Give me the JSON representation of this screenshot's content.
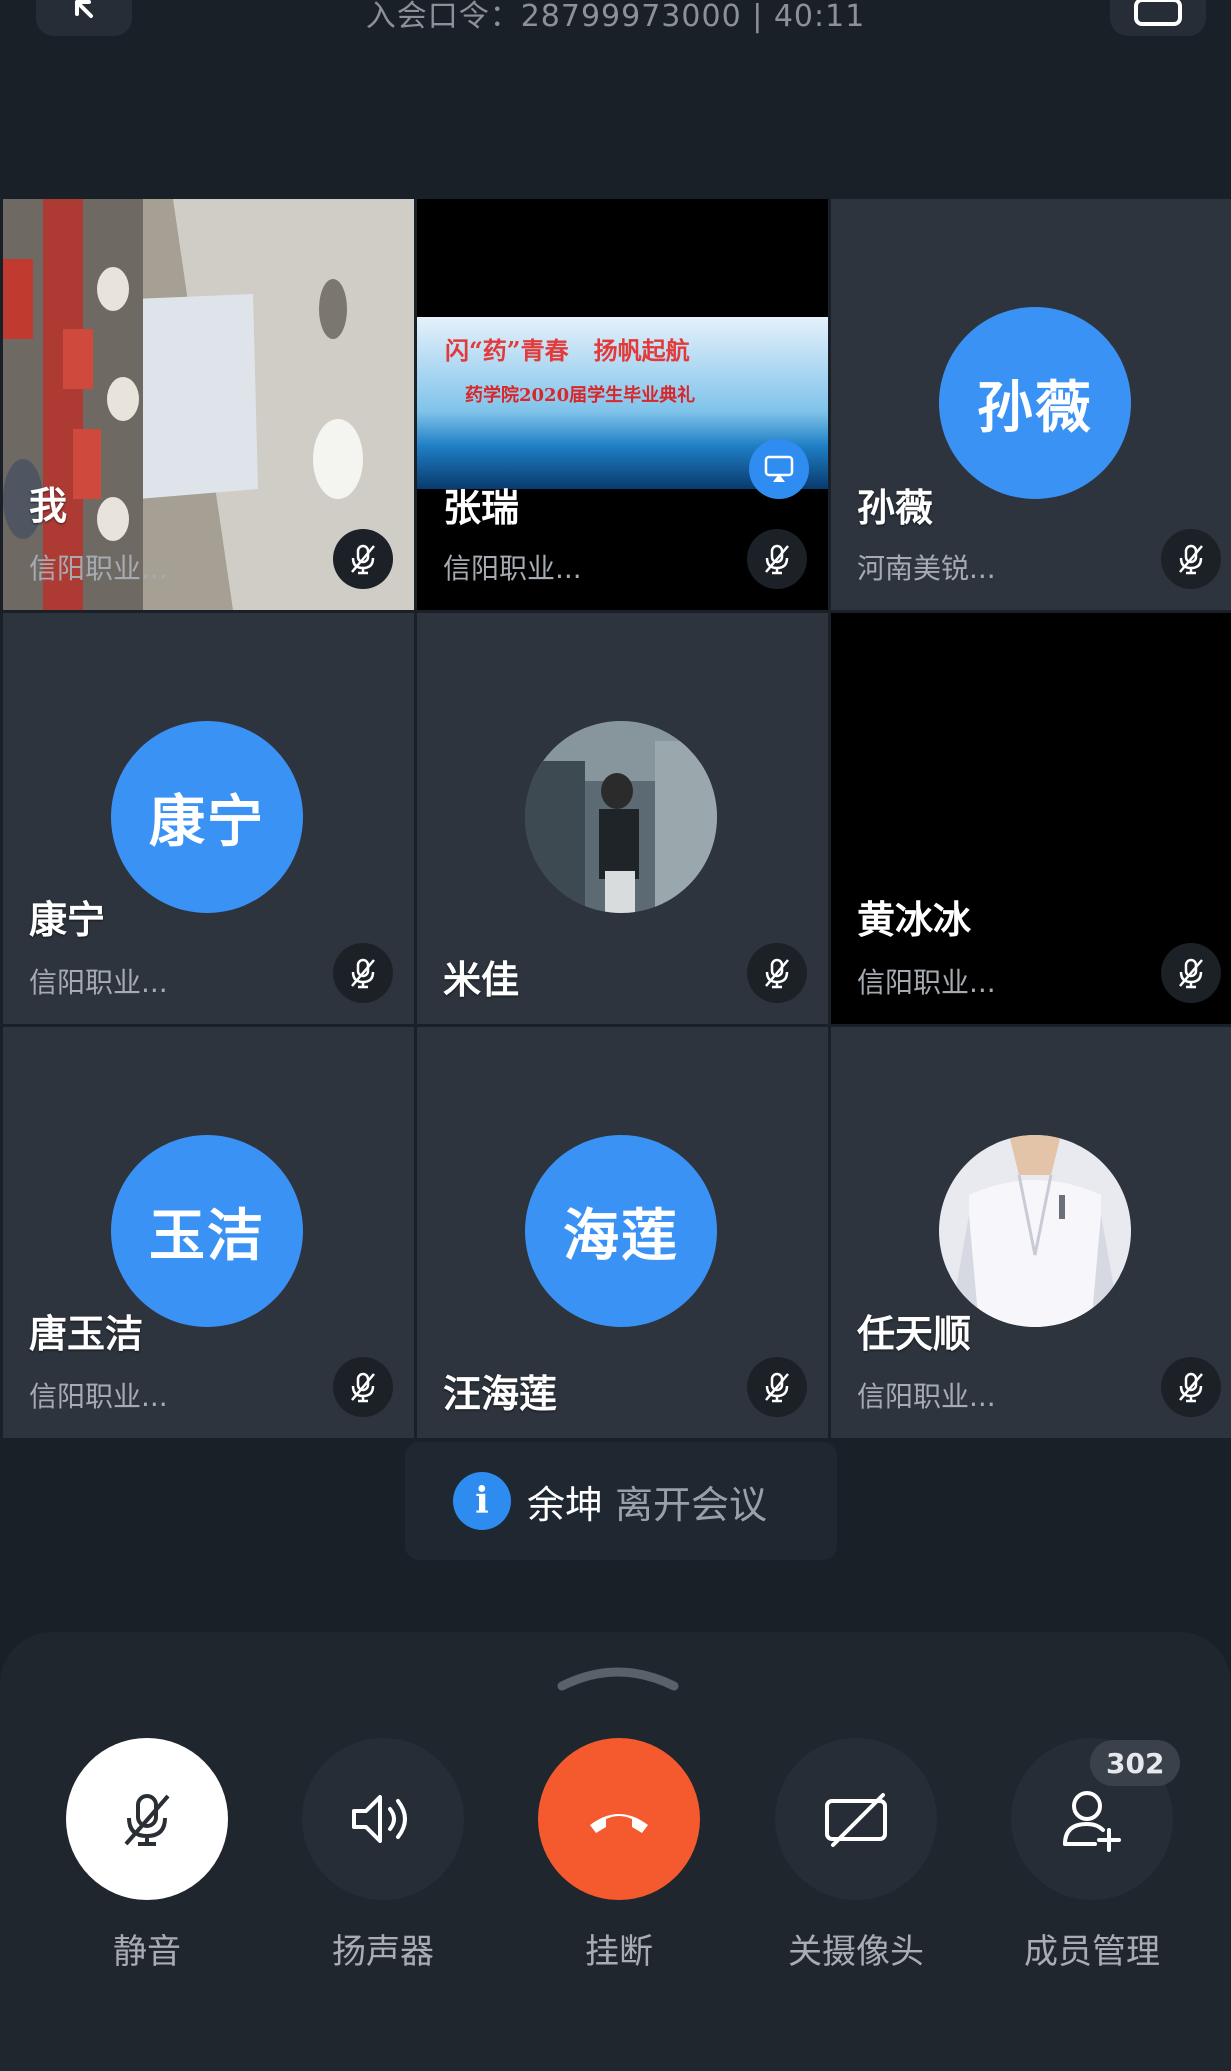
{
  "header": {
    "meeting_info": "入会口令：28799973000 | 40:11",
    "back_icon": "back-arrow-icon",
    "switch_icon": "camera-switch-icon"
  },
  "participants": [
    {
      "name": "我",
      "org": "信阳职业...",
      "type": "video",
      "muted": true
    },
    {
      "name": "张瑞",
      "org": "信阳职业...",
      "type": "screen-share",
      "muted": true,
      "share_title": "闪“药”青春   扬帆起航",
      "share_subtitle": "药学院2020届学生毕业典礼"
    },
    {
      "name": "孙薇",
      "org": "河南美锐...",
      "type": "avatar",
      "avatar_text": "孙薇",
      "muted": true
    },
    {
      "name": "康宁",
      "org": "信阳职业...",
      "type": "avatar",
      "avatar_text": "康宁",
      "muted": true
    },
    {
      "name": "米佳",
      "org": "",
      "type": "photo",
      "muted": true
    },
    {
      "name": "黄冰冰",
      "org": "信阳职业...",
      "type": "black",
      "muted": true
    },
    {
      "name": "唐玉洁",
      "org": "信阳职业...",
      "type": "avatar",
      "avatar_text": "玉洁",
      "muted": true
    },
    {
      "name": "汪海莲",
      "org": "",
      "type": "avatar",
      "avatar_text": "海莲",
      "muted": true
    },
    {
      "name": "任天顺",
      "org": "信阳职业...",
      "type": "photo-coat",
      "muted": true
    }
  ],
  "toast": {
    "name": "余坤",
    "message": "离开会议",
    "icon": "info-icon"
  },
  "controls": {
    "mute_label": "静音",
    "speaker_label": "扬声器",
    "hangup_label": "挂断",
    "camera_label": "关摄像头",
    "members_label": "成员管理",
    "member_count": "302"
  },
  "colors": {
    "accent": "#3a93f4",
    "hangup": "#f45a2d",
    "background": "#1a2028",
    "tile": "#2d343d"
  }
}
